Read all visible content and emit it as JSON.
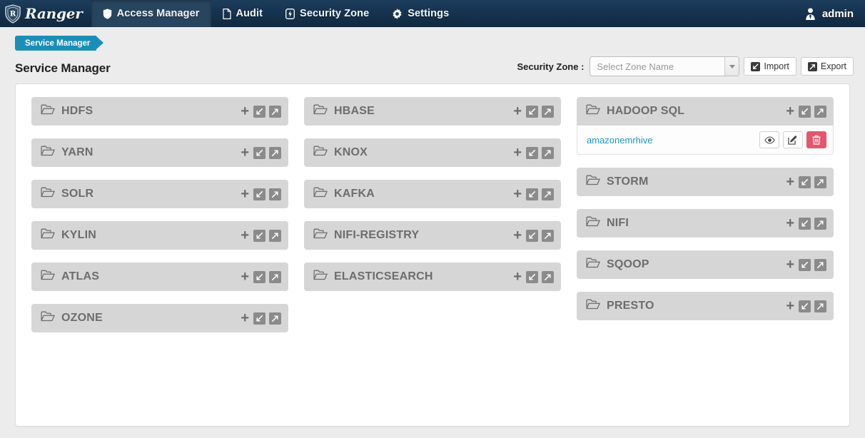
{
  "navbar": {
    "brand": "Ranger",
    "brand_icon": "ranger-shield-logo",
    "items": [
      {
        "label": "Access Manager",
        "icon": "shield-icon",
        "active": true
      },
      {
        "label": "Audit",
        "icon": "file-icon",
        "active": false
      },
      {
        "label": "Security Zone",
        "icon": "bolt-icon",
        "active": false
      },
      {
        "label": "Settings",
        "icon": "gear-icon",
        "active": false
      }
    ],
    "user": {
      "label": "admin",
      "icon": "user-tie-icon"
    }
  },
  "breadcrumb": {
    "label": "Service Manager"
  },
  "page": {
    "title": "Service Manager"
  },
  "toolbar": {
    "security_zone_label": "Security Zone :",
    "zone_select": {
      "placeholder": "Select Zone Name",
      "value": ""
    },
    "import_label": "Import",
    "export_label": "Export"
  },
  "colors": {
    "navbar_bg": "#15324f",
    "navbar_active": "#27455f",
    "breadcrumb": "#1b8eb8",
    "card_header": "#d6d6d6",
    "card_title_text": "#6d6d6d",
    "link": "#1f96c4",
    "delete_button": "#e4576c",
    "page_bg": "#ececec"
  },
  "card_actions": {
    "add_icon": "plus-icon",
    "import_icon": "arrow-down-left-box-icon",
    "export_icon": "arrow-up-right-box-icon"
  },
  "service_row_actions": {
    "view_icon": "eye-icon",
    "edit_icon": "pencil-square-icon",
    "delete_icon": "trash-icon"
  },
  "columns": [
    {
      "cards": [
        {
          "name": "HDFS",
          "icon": "folder-open-icon",
          "services": []
        },
        {
          "name": "YARN",
          "icon": "folder-open-icon",
          "services": []
        },
        {
          "name": "SOLR",
          "icon": "folder-open-icon",
          "services": []
        },
        {
          "name": "KYLIN",
          "icon": "folder-open-icon",
          "services": []
        },
        {
          "name": "ATLAS",
          "icon": "folder-open-icon",
          "services": []
        },
        {
          "name": "OZONE",
          "icon": "folder-open-icon",
          "services": []
        }
      ]
    },
    {
      "cards": [
        {
          "name": "HBASE",
          "icon": "folder-open-icon",
          "services": []
        },
        {
          "name": "KNOX",
          "icon": "folder-open-icon",
          "services": []
        },
        {
          "name": "KAFKA",
          "icon": "folder-open-icon",
          "services": []
        },
        {
          "name": "NIFI-REGISTRY",
          "icon": "folder-open-icon",
          "services": []
        },
        {
          "name": "ELASTICSEARCH",
          "icon": "folder-open-icon",
          "services": []
        }
      ]
    },
    {
      "cards": [
        {
          "name": "HADOOP SQL",
          "icon": "folder-open-icon",
          "services": [
            "amazonemrhive"
          ]
        },
        {
          "name": "STORM",
          "icon": "folder-open-icon",
          "services": []
        },
        {
          "name": "NIFI",
          "icon": "folder-open-icon",
          "services": []
        },
        {
          "name": "SQOOP",
          "icon": "folder-open-icon",
          "services": []
        },
        {
          "name": "PRESTO",
          "icon": "folder-open-icon",
          "services": []
        }
      ]
    }
  ]
}
